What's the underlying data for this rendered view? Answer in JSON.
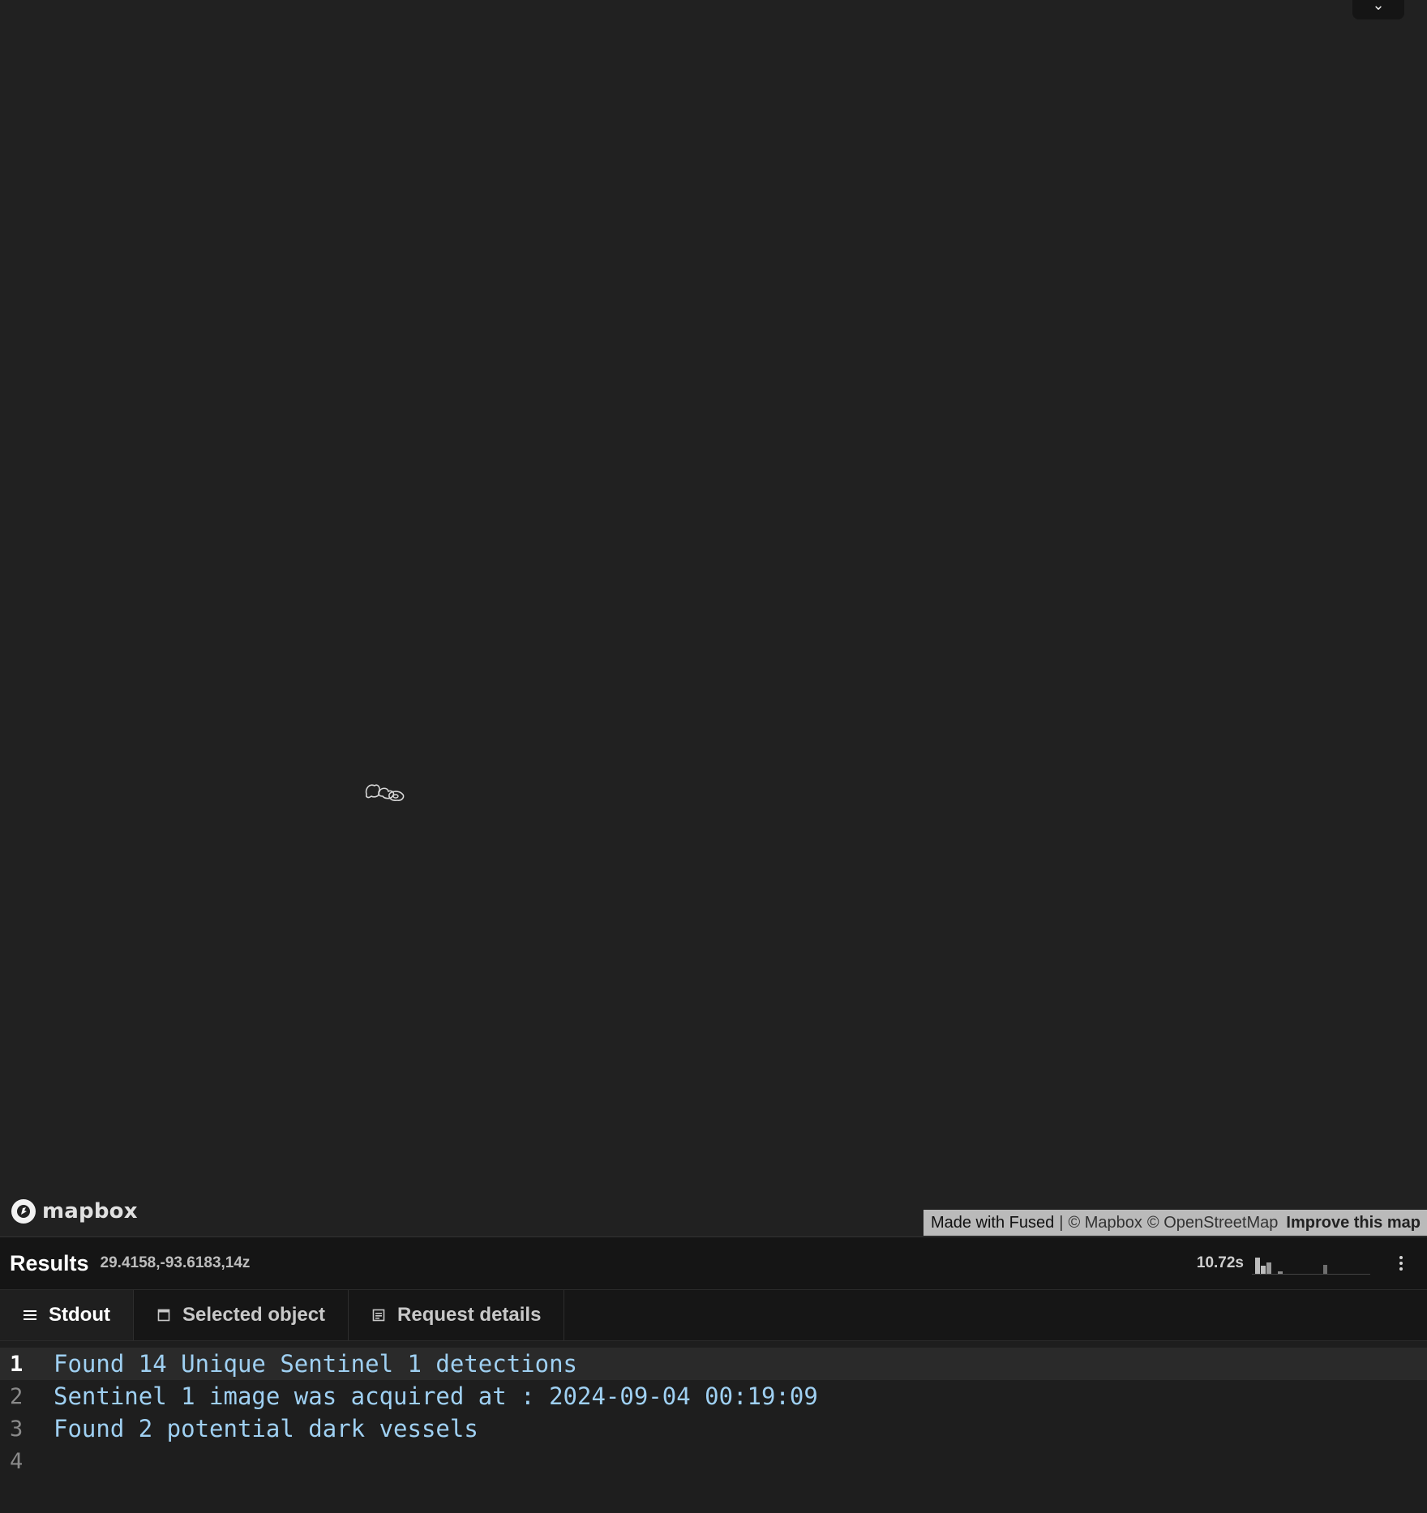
{
  "map": {
    "logo_text": "mapbox",
    "attribution": {
      "made_with": "Made with Fused",
      "separator": "|",
      "mapbox": "© Mapbox",
      "osm": "© OpenStreetMap",
      "improve": "Improve this map"
    }
  },
  "results": {
    "title": "Results",
    "coords": "29.4158,-93.6183,14z",
    "timing": "10.72s"
  },
  "tabs": [
    {
      "label": "Stdout",
      "icon": "list-icon",
      "active": true
    },
    {
      "label": "Selected object",
      "icon": "square-icon",
      "active": false
    },
    {
      "label": "Request details",
      "icon": "grid-icon",
      "active": false
    }
  ],
  "console": {
    "lines": [
      {
        "number": "1",
        "text": "Found 14 Unique Sentinel 1 detections"
      },
      {
        "number": "2",
        "text": "Sentinel 1 image was acquired at : 2024-09-04 00:19:09"
      },
      {
        "number": "3",
        "text": "Found 2 potential dark vessels"
      },
      {
        "number": "4",
        "text": ""
      }
    ]
  },
  "colors": {
    "background": "#212121",
    "panel": "#151515",
    "console_text": "#9fd0f2",
    "attribution_bg": "#c8c8c8"
  }
}
